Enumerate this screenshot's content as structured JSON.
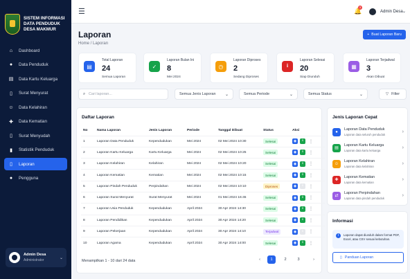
{
  "sidebar": {
    "brand": [
      "SISTEM INFORMASI",
      "DATA PENDUDUK",
      "DESA MAKMUR"
    ],
    "items": [
      {
        "label": "Dashboard",
        "icon": "home-icon"
      },
      {
        "label": "Data Penduduk",
        "icon": "users-icon"
      },
      {
        "label": "Data Kartu Keluarga",
        "icon": "id-card-icon"
      },
      {
        "label": "Surat Menyurat",
        "icon": "file-icon"
      },
      {
        "label": "Data Kelahiran",
        "icon": "baby-icon"
      },
      {
        "label": "Data Kematian",
        "icon": "cross-icon"
      },
      {
        "label": "Surat Menyudah",
        "icon": "file-export-icon"
      },
      {
        "label": "Statistik Penduduk",
        "icon": "chart-icon"
      },
      {
        "label": "Laporan",
        "icon": "report-icon"
      },
      {
        "label": "Pengguna",
        "icon": "user-icon"
      }
    ],
    "user": {
      "name": "Admin Desa",
      "role": "Administrator"
    }
  },
  "topbar": {
    "notif_count": "3",
    "user": "Admin Desa"
  },
  "page": {
    "title": "Laporan",
    "breadcrumb": "Home  /  Laporan",
    "new_button": "Buat Laporan Baru"
  },
  "stats": [
    {
      "label": "Total Laporan",
      "value": "24",
      "sub": "Semua Laporan",
      "color": "#2563eb"
    },
    {
      "label": "Laporan Bulan Ini",
      "value": "8",
      "sub": "Mei 2024",
      "color": "#16a34a"
    },
    {
      "label": "Laporan Diproses",
      "value": "2",
      "sub": "Sedang Diproses",
      "color": "#f59e0b"
    },
    {
      "label": "Laporan Selesai",
      "value": "20",
      "sub": "Siap Diunduh",
      "color": "#dc2626"
    },
    {
      "label": "Laporan Terjadwal",
      "value": "3",
      "sub": "Akan Dibuat",
      "color": "#9b5de5"
    }
  ],
  "filters": {
    "search_placeholder": "Cari laporan...",
    "jenis": "Semua Jenis Laporan",
    "periode": "Semua Periode",
    "status": "Semua Status",
    "filter_button": "Filter"
  },
  "table": {
    "title": "Daftar Laporan",
    "headers": [
      "No",
      "Nama Laporan",
      "Jenis Laporan",
      "Periode",
      "Tanggal Dibuat",
      "Status",
      "Aksi"
    ],
    "rows": [
      {
        "no": "1",
        "nama": "Laporan Data Penduduk",
        "jenis": "Kependudukan",
        "periode": "Mei 2024",
        "tanggal": "02 Mei 2024 10:30",
        "status": "Selesai"
      },
      {
        "no": "2",
        "nama": "Laporan Kartu Keluarga",
        "jenis": "Kartu Keluarga",
        "periode": "Mei 2024",
        "tanggal": "02 Mei 2024 10:25",
        "status": "Selesai"
      },
      {
        "no": "3",
        "nama": "Laporan Kelahiran",
        "jenis": "Kelahiran",
        "periode": "Mei 2024",
        "tanggal": "02 Mei 2024 10:20",
        "status": "Selesai"
      },
      {
        "no": "4",
        "nama": "Laporan Kematian",
        "jenis": "Kematian",
        "periode": "Mei 2024",
        "tanggal": "02 Mei 2024 10:15",
        "status": "Selesai"
      },
      {
        "no": "5",
        "nama": "Laporan Pindah Penduduk",
        "jenis": "Perpindahan",
        "periode": "Mei 2024",
        "tanggal": "02 Mei 2024 10:10",
        "status": "Diproses"
      },
      {
        "no": "6",
        "nama": "Laporan Surat Menyurat",
        "jenis": "Surat Menyurat",
        "periode": "Mei 2024",
        "tanggal": "01 Mei 2024 16:45",
        "status": "Selesai"
      },
      {
        "no": "7",
        "nama": "Laporan Usia Penduduk",
        "jenis": "Kependudukan",
        "periode": "April 2024",
        "tanggal": "30 Apr 2024 14:30",
        "status": "Selesai"
      },
      {
        "no": "8",
        "nama": "Laporan Pendidikan",
        "jenis": "Kependudukan",
        "periode": "April 2024",
        "tanggal": "30 Apr 2024 14:20",
        "status": "Selesai"
      },
      {
        "no": "9",
        "nama": "Laporan Pekerjaan",
        "jenis": "Kependudukan",
        "periode": "April 2024",
        "tanggal": "30 Apr 2024 14:10",
        "status": "Terjadwal"
      },
      {
        "no": "10",
        "nama": "Laporan Agama",
        "jenis": "Kependudukan",
        "periode": "April 2024",
        "tanggal": "30 Apr 2024 14:00",
        "status": "Selesai"
      }
    ],
    "footer": "Menampilkan 1 - 10 dari 24 data",
    "pages": [
      "1",
      "2",
      "3"
    ]
  },
  "jenis_cepat": {
    "title": "Jenis Laporan Cepat",
    "items": [
      {
        "title": "Laporan Data Penduduk",
        "sub": "Laporan data seluruh penduduk",
        "color": "#2563eb",
        "icon": "users-icon"
      },
      {
        "title": "Laporan Kartu Keluarga",
        "sub": "Laporan data kartu keluarga",
        "color": "#16a34a",
        "icon": "id-card-icon"
      },
      {
        "title": "Laporan Kelahiran",
        "sub": "Laporan data kelahiran",
        "color": "#f59e0b",
        "icon": "baby-icon"
      },
      {
        "title": "Laporan Kematian",
        "sub": "Laporan data kematian",
        "color": "#dc2626",
        "icon": "cross-icon"
      },
      {
        "title": "Laporan Perpindahan",
        "sub": "Laporan data pindah penduduk",
        "color": "#9b5de5",
        "icon": "swap-icon"
      }
    ]
  },
  "informasi": {
    "title": "Informasi",
    "text": "Laporan dapat diunduh dalam format PDF, Excel, atau CSV sesuai kebutuhan.",
    "guide_button": "Panduan Laporan"
  }
}
